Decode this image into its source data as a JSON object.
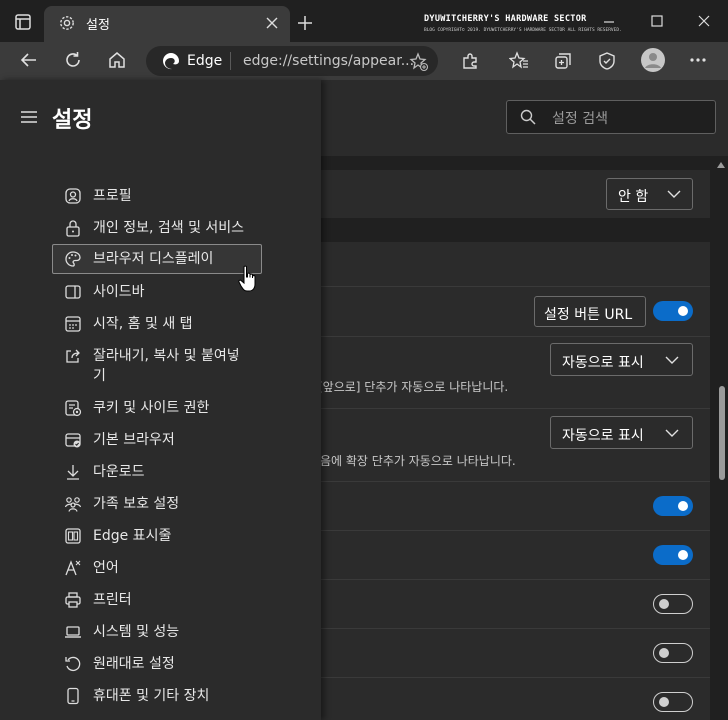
{
  "window": {
    "tab_title": "설정",
    "watermark_title": "DYUWITCHERRY'S HARDWARE SECTOR",
    "watermark_sub": "BLOG COPYRIGHT© 2019. DYUWITCHERRY'S HARDWARE SECTOR ALL RIGHTS RESERVED."
  },
  "address_bar": {
    "brand": "Edge",
    "url": "edge://settings/appear..."
  },
  "sidebar": {
    "title": "설정",
    "items": [
      {
        "label": "프로필",
        "icon": "profile-icon"
      },
      {
        "label": "개인 정보, 검색 및 서비스",
        "icon": "lock-icon"
      },
      {
        "label": "브라우저 디스플레이",
        "icon": "palette-icon",
        "active": true
      },
      {
        "label": "사이드바",
        "icon": "sidebar-icon"
      },
      {
        "label": "시작, 홈 및 새 탭",
        "icon": "start-home-icon"
      },
      {
        "label": "잘라내기, 복사 및 붙여넣",
        "label2": "기",
        "icon": "share-icon"
      },
      {
        "label": "쿠키 및 사이트 권한",
        "icon": "cookie-icon"
      },
      {
        "label": "기본 브라우저",
        "icon": "default-browser-icon"
      },
      {
        "label": "다운로드",
        "icon": "download-icon"
      },
      {
        "label": "가족 보호 설정",
        "icon": "family-icon"
      },
      {
        "label": "Edge 표시줄",
        "icon": "edge-bar-icon"
      },
      {
        "label": "언어",
        "icon": "language-icon"
      },
      {
        "label": "프린터",
        "icon": "printer-icon"
      },
      {
        "label": "시스템 및 성능",
        "icon": "system-icon"
      },
      {
        "label": "원래대로 설정",
        "icon": "reset-icon"
      },
      {
        "label": "휴대폰 및 기타 장치",
        "icon": "phone-icon"
      }
    ]
  },
  "search": {
    "placeholder": "설정 검색"
  },
  "content": {
    "theme_dropdown": "안 함",
    "settings_button_url": "설정 버튼 URL",
    "toolbar_dropdown1": "자동으로 표시",
    "toolbar_desc1": "[앞으로] 단추가 자동으로 나타납니다.",
    "toolbar_dropdown2": "자동으로 표시",
    "toolbar_desc2": "음에 확장 단추가 자동으로 나타납니다.",
    "toggles": [
      true,
      true,
      true,
      false,
      false,
      false
    ]
  },
  "colors": {
    "accent": "#0b6cc9",
    "active_bar": "#4ca0ff"
  }
}
